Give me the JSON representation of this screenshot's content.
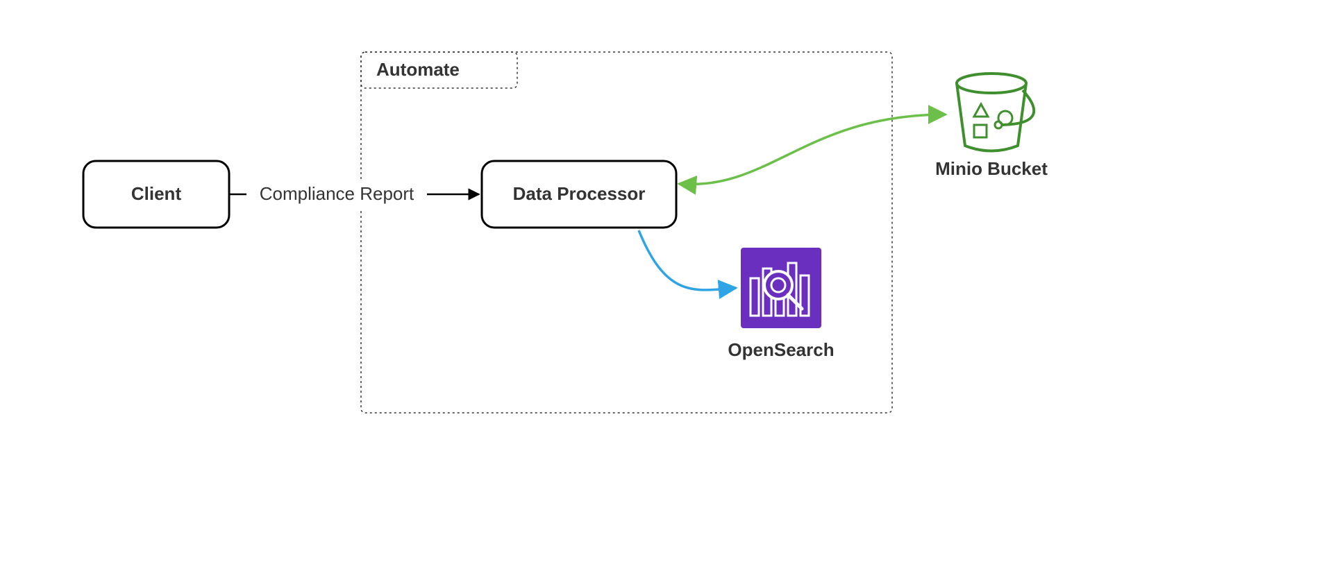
{
  "nodes": {
    "client": {
      "label": "Client"
    },
    "automate": {
      "label": "Automate"
    },
    "data_processor": {
      "label": "Data Processor"
    },
    "minio": {
      "label": "Minio Bucket"
    },
    "opensearch": {
      "label": "OpenSearch"
    }
  },
  "edges": {
    "compliance_report": {
      "label": "Compliance Report"
    }
  },
  "colors": {
    "green": "#6cc04a",
    "dark_green": "#3f8f2f",
    "blue": "#2ea3e6",
    "purple": "#6b2fbf"
  }
}
